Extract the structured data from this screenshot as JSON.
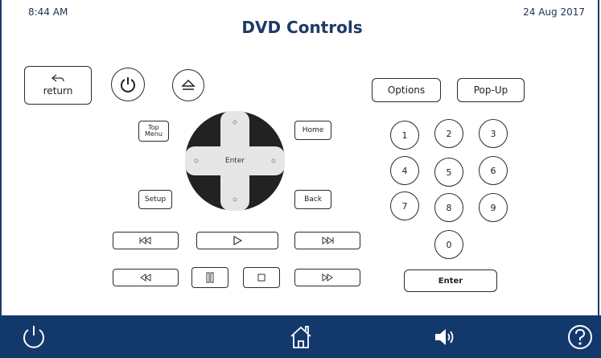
{
  "status": {
    "time": "8:44 AM",
    "date": "24 Aug 2017"
  },
  "title": "DVD Controls",
  "left_controls": {
    "return_label": "return",
    "top_menu_label_line1": "Top",
    "top_menu_label_line2": "Menu",
    "home_label": "Home",
    "setup_label": "Setup",
    "back_label": "Back",
    "enter_label": "Enter"
  },
  "right_controls": {
    "options_label": "Options",
    "popup_label": "Pop-Up",
    "digits": [
      "1",
      "2",
      "3",
      "4",
      "5",
      "6",
      "7",
      "8",
      "9",
      "0"
    ],
    "enter_label": "Enter"
  },
  "footer": {
    "icons": [
      "power-icon",
      "home-icon",
      "volume-icon",
      "help-icon"
    ]
  },
  "colors": {
    "brand": "#1f3a68",
    "footer": "#13386b",
    "dpad": "#222222",
    "dpad_cross": "#e6e6e6"
  }
}
